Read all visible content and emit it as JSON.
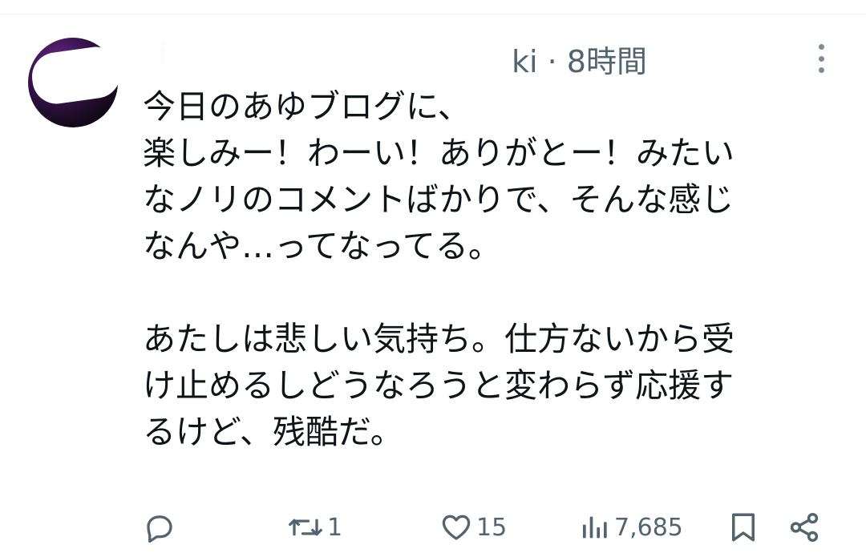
{
  "tweet": {
    "author_name_obscured": "ki",
    "timestamp": "ki · 8時間",
    "body_paragraph_1": "今日のあゆブログに、\n楽しみー！わーい！ありがとー！みたい\nなノリのコメントばかりで、そんな感じ\nなんや…ってなってる。",
    "body_paragraph_2": "あたしは悲しい気持ち。仕方ないから受\nけ止めるしどうなろうと変わらず応援す\nるけど、残酷だ。"
  },
  "actions": {
    "reply_count": "",
    "retweet_count": "1",
    "like_count": "15",
    "views_count": "7,685"
  },
  "icons": {
    "reply": "reply-icon",
    "retweet": "retweet-icon",
    "like": "heart-icon",
    "views": "views-chart-icon",
    "bookmark": "bookmark-icon",
    "share": "share-icon",
    "more": "more-dots-icon"
  },
  "colors": {
    "text": "#0f1419",
    "secondary": "#536471"
  }
}
